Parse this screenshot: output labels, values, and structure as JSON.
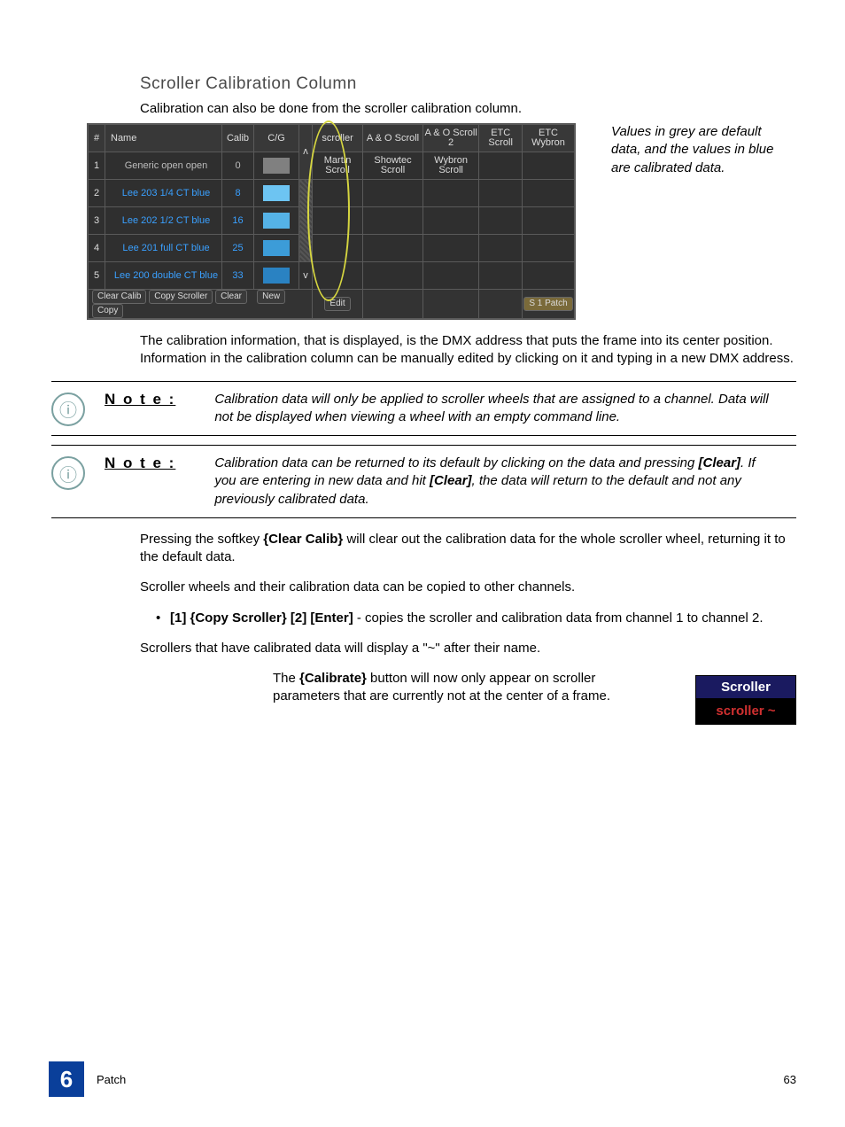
{
  "section_title": "Scroller Calibration Column",
  "intro": "Calibration can also be done from the scroller calibration column.",
  "table": {
    "headers": {
      "num": "#",
      "name": "Name",
      "calib": "Calib",
      "cg": "C/G",
      "cols": [
        "scroller",
        "A & O Scroll",
        "A & O Scroll 2",
        "ETC Scroll",
        "ETC Wybron"
      ]
    },
    "row1_labels": [
      "Martin Scroll",
      "Showtec Scroll",
      "Wybron Scroll",
      "",
      ""
    ],
    "rows": [
      {
        "num": "1",
        "name": "Generic open open",
        "calib": "0",
        "sw": "sw-grey",
        "blue": false
      },
      {
        "num": "2",
        "name": "Lee 203 1/4 CT blue",
        "calib": "8",
        "sw": "sw-b1",
        "blue": true
      },
      {
        "num": "3",
        "name": "Lee 202 1/2 CT blue",
        "calib": "16",
        "sw": "sw-b2",
        "blue": true
      },
      {
        "num": "4",
        "name": "Lee 201 full CT blue",
        "calib": "25",
        "sw": "sw-b3",
        "blue": true
      },
      {
        "num": "5",
        "name": "Lee 200 double CT blue",
        "calib": "33",
        "sw": "sw-b4",
        "blue": true
      }
    ],
    "buttons": {
      "clear_calib": "Clear Calib",
      "copy_scroller": "Copy Scroller",
      "clear": "Clear",
      "new": "New",
      "copy": "Copy",
      "edit": "Edit",
      "patch": "S 1 Patch"
    }
  },
  "aside": {
    "line1": "Values in grey are default data, and the values in blue are calibrated data."
  },
  "para1": "The calibration information, that is displayed, is the DMX address that puts the frame into its center position. Information in the calibration column can be manually edited by clicking on it and typing in a new DMX address.",
  "note_label": "N o t e :",
  "note1": "Calibration data will only be applied to scroller wheels that are assigned to a channel. Data will not be displayed when viewing a wheel with an empty command line.",
  "note2_pre": "Calibration data can be returned to its default by clicking on the data and pressing ",
  "note2_b1": "[Clear]",
  "note2_mid": ". If you are entering in new data and hit ",
  "note2_b2": "[Clear]",
  "note2_post": ", the data will return to the default and not any previously calibrated data.",
  "para2_pre": "Pressing the softkey ",
  "para2_b": "{Clear Calib}",
  "para2_post": " will clear out the calibration data for the whole scroller wheel, returning it to the default data.",
  "para3": "Scroller wheels and their calibration data can be copied to other channels.",
  "bullet_b": "[1] {Copy Scroller} [2] [Enter]",
  "bullet_post": " - copies the scroller and calibration data from channel 1 to channel 2.",
  "para4": "Scrollers that have calibrated data will display a \"~\" after their name.",
  "scroller_box": {
    "top": "Scroller",
    "bottom": "scroller ~"
  },
  "cal_para_pre": "The ",
  "cal_para_b": "{Calibrate}",
  "cal_para_post": " button will now only appear on scroller parameters that are currently not at the center of a frame.",
  "footer": {
    "chapter": "6",
    "label": "Patch",
    "page": "63"
  }
}
